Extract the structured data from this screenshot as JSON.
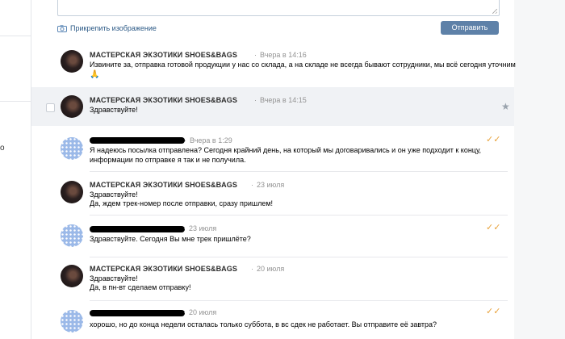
{
  "composer": {
    "attach_label": "Прикрепить изображение",
    "send_label": "Отправить"
  },
  "left_fragment": "о",
  "messages": [
    {
      "author": "МАСТЕРСКАЯ ЭКЗОТИКИ SHOES&BAGS",
      "time": "Вчера в 14:16",
      "lines": [
        "Извините за, отправка готовой продукции у нас со склада, а на складе не всегда бывают сотрудники, мы всё сегодня уточним",
        "🙏"
      ]
    },
    {
      "author": "МАСТЕРСКАЯ ЭКЗОТИКИ SHOES&BAGS",
      "time": "Вчера в 14:15",
      "lines": [
        "Здравствуйте!"
      ],
      "selected": true
    },
    {
      "author": "",
      "time": "Вчера в 1:29",
      "lines": [
        "Я надеюсь посылка отправлена? Сегодня крайний день, на который мы договаривались и он уже подходит к концу,",
        "информации по отправке я так и не получила."
      ],
      "read_check": "✓✓"
    },
    {
      "author": "МАСТЕРСКАЯ ЭКЗОТИКИ SHOES&BAGS",
      "time": "23 июля",
      "lines": [
        "Здравствуйте!",
        "Да, ждем трек-номер после отправки, сразу пришлем!"
      ]
    },
    {
      "author": "",
      "time": "23 июля",
      "lines": [
        "Здравствуйте. Сегодня Вы мне трек пришлёте?"
      ],
      "read_check": "✓✓"
    },
    {
      "author": "МАСТЕРСКАЯ ЭКЗОТИКИ SHOES&BAGS",
      "time": "20 июля",
      "lines": [
        "Здравствуйте!",
        "Да, в пн-вт сделаем отправку!"
      ]
    },
    {
      "author": "",
      "time": "20 июля",
      "lines": [
        "хорошо, но до конца недели осталась только суббота, в вс сдек не работает. Вы отправите её завтра?"
      ],
      "read_check": "✓✓"
    }
  ],
  "icons": {
    "camera": "camera-icon",
    "star": "star-icon",
    "check": "double-check-icon"
  },
  "colors": {
    "link": "#2a5885",
    "send_button": "#5e81a8",
    "check": "#e8a23a",
    "selected_row": "#f0f2f5"
  }
}
